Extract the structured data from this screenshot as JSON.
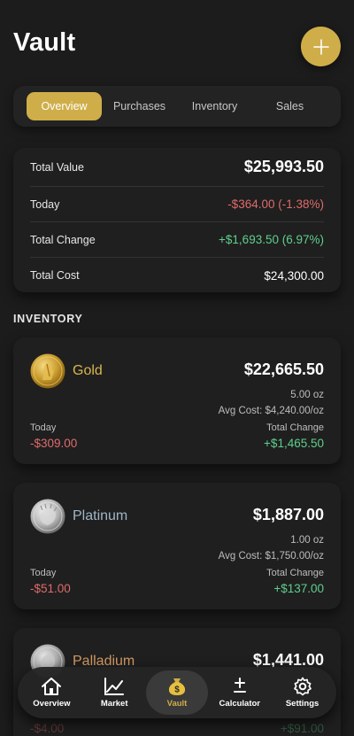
{
  "header": {
    "title": "Vault",
    "add_label": "+"
  },
  "tabs": [
    {
      "label": "Overview",
      "active": true
    },
    {
      "label": "Purchases",
      "active": false
    },
    {
      "label": "Inventory",
      "active": false
    },
    {
      "label": "Sales",
      "active": false
    }
  ],
  "summary": {
    "total_value_label": "Total Value",
    "total_value": "$25,993.50",
    "today_label": "Today",
    "today": "-$364.00 (-1.38%)",
    "total_change_label": "Total Change",
    "total_change": "+$1,693.50 (6.97%)",
    "total_cost_label": "Total Cost",
    "total_cost": "$24,300.00"
  },
  "inventory": {
    "title": "INVENTORY",
    "items": [
      {
        "name": "Gold",
        "value": "$22,665.50",
        "oz": "5.00 oz",
        "avg": "Avg Cost: $4,240.00/oz",
        "today_label": "Today",
        "today": "-$309.00",
        "tc_label": "Total Change",
        "tc": "+$1,465.50"
      },
      {
        "name": "Platinum",
        "value": "$1,887.00",
        "oz": "1.00 oz",
        "avg": "Avg Cost: $1,750.00/oz",
        "today_label": "Today",
        "today": "-$51.00",
        "tc_label": "Total Change",
        "tc": "+$137.00"
      },
      {
        "name": "Palladium",
        "value": "$1,441.00",
        "today": "-$4.00",
        "tc": "+$91.00"
      }
    ]
  },
  "nav": [
    {
      "label": "Overview",
      "icon": "home-icon",
      "active": false
    },
    {
      "label": "Market",
      "icon": "chart-line-icon",
      "active": false
    },
    {
      "label": "Vault",
      "icon": "money-bag-icon",
      "active": true
    },
    {
      "label": "Calculator",
      "icon": "plus-minus-icon",
      "active": false
    },
    {
      "label": "Settings",
      "icon": "gear-icon",
      "active": false
    }
  ],
  "colors": {
    "accent": "#cfae4a",
    "negative": "#e06a6a",
    "positive": "#5fcf8c",
    "background": "#1c1c1c"
  }
}
